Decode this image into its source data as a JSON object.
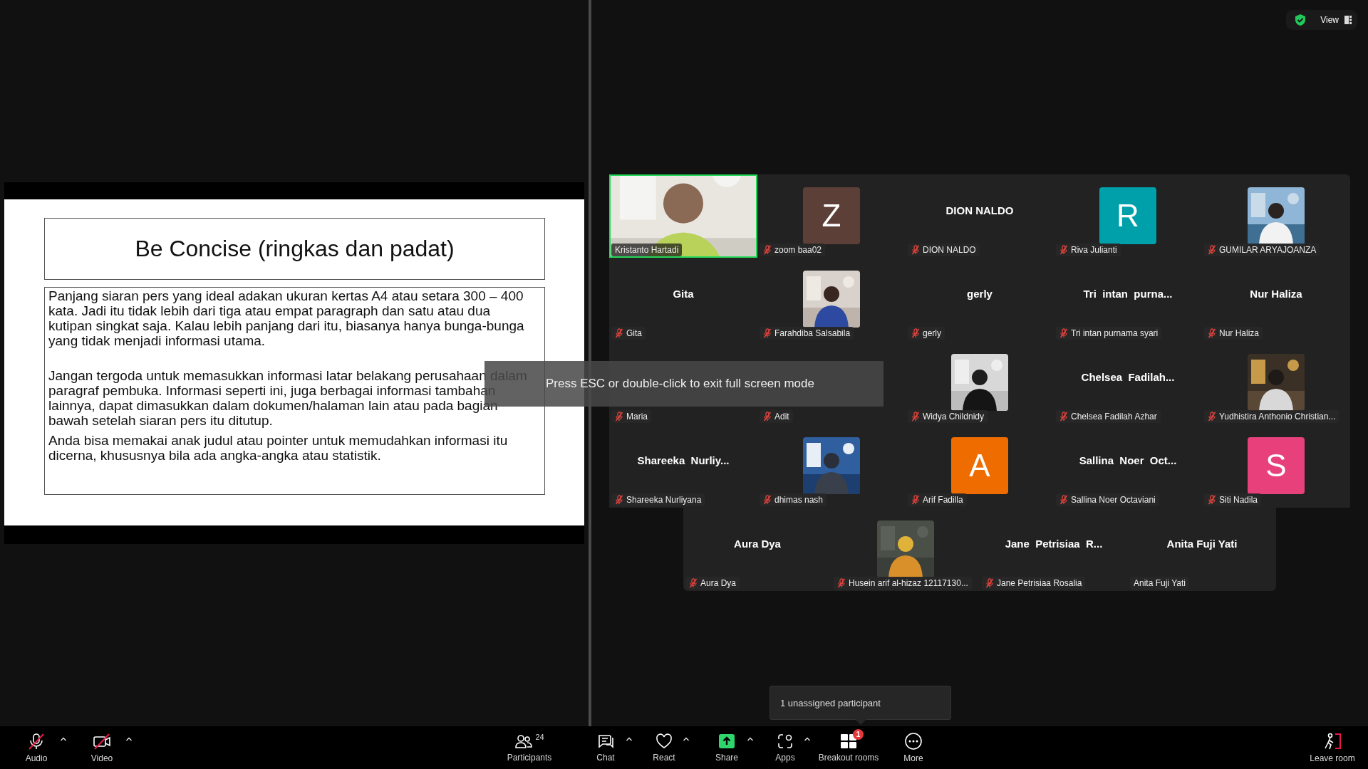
{
  "view_bar": {
    "label": "View"
  },
  "slide": {
    "title": "Be Concise (ringkas dan padat)",
    "paragraphs": [
      "Panjang siaran pers yang ideal adakan ukuran kertas A4 atau setara 300 – 400 kata. Jadi itu tidak lebih dari tiga atau empat paragraph dan satu atau dua kutipan singkat saja. Kalau lebih panjang dari itu, biasanya hanya bunga-bunga yang tidak menjadi informasi utama.",
      "Jangan tergoda untuk memasukkan informasi latar belakang perusahaan dalam paragraf pembuka. Informasi seperti ini, juga berbagai informasi tambahan lainnya, dapat dimasukkan dalam dokumen/halaman lain atau pada bagian bawah setelah siaran pers itu ditutup.",
      "Anda bisa memakai anak judul atau pointer untuk memudahkan informasi itu dicerna, khususnya bila ada angka-angka atau statistik."
    ]
  },
  "fullscreen_notice": "Press ESC or double-click to exit full screen mode",
  "gallery": {
    "rows": [
      {
        "tiles": [
          {
            "kind": "video",
            "name": "Kristanto Hartadi",
            "muted": false,
            "speaking": true
          },
          {
            "kind": "letter",
            "letter": "Z",
            "color": "#5c4038",
            "name": "zoom baa02",
            "muted": true,
            "speaking": false
          },
          {
            "kind": "name",
            "display": "DION NALDO",
            "name": "DION NALDO",
            "muted": true,
            "speaking": false
          },
          {
            "kind": "letter",
            "letter": "R",
            "color": "#00a0ab",
            "name": "Riva Julianti",
            "muted": true,
            "speaking": false
          },
          {
            "name": "GUMILAR ARYAJOANZA",
            "muted": true,
            "speaking": false
          }
        ]
      },
      {
        "tiles": [
          {
            "kind": "name",
            "display": "Gita",
            "name": "Gita",
            "muted": true,
            "speaking": false
          },
          {
            "name": "Farahdiba Salsabila",
            "muted": true,
            "speaking": false
          },
          {
            "kind": "name",
            "display": "gerly",
            "name": "gerly",
            "muted": true,
            "speaking": false
          },
          {
            "kind": "name",
            "display": "Tri  intan  purna...",
            "name": "Tri intan purnama syari",
            "muted": true,
            "speaking": false
          },
          {
            "kind": "name",
            "display": "Nur Haliza",
            "name": "Nur Haliza",
            "muted": true,
            "speaking": false
          }
        ]
      },
      {
        "tiles": [
          {
            "kind": "name",
            "name": "Maria",
            "muted": true,
            "speaking": false
          },
          {
            "kind": "name",
            "name": "Adit",
            "muted": true,
            "speaking": false
          },
          {
            "name": "Widya Childnidy",
            "muted": true,
            "speaking": false
          },
          {
            "kind": "name",
            "display": "Chelsea  Fadilah...",
            "name": "Chelsea Fadilah Azhar",
            "muted": true,
            "speaking": false
          },
          {
            "name": "Yudhistira Anthonio Christian...",
            "muted": true,
            "speaking": false
          }
        ]
      },
      {
        "tiles": [
          {
            "kind": "name",
            "display": "Shareeka  Nurliy...",
            "name": "Shareeka Nurliyana",
            "muted": true,
            "speaking": false
          },
          {
            "name": "dhimas nash",
            "muted": true,
            "speaking": false
          },
          {
            "kind": "letter",
            "letter": "A",
            "color": "#ef6c00",
            "name": "Arif Fadilla",
            "muted": true,
            "speaking": false
          },
          {
            "kind": "name",
            "display": "Sallina  Noer  Oct...",
            "name": "Sallina Noer Octaviani",
            "muted": true,
            "speaking": false
          },
          {
            "kind": "letter",
            "letter": "S",
            "color": "#e8407a",
            "name": "Siti Nadila",
            "muted": true,
            "speaking": false
          }
        ]
      },
      {
        "tiles": [
          {
            "kind": "name",
            "display": "Aura Dya",
            "name": "Aura Dya",
            "muted": true,
            "speaking": false
          },
          {
            "name": "Husein arif al-hizaz 12117130...",
            "muted": true,
            "speaking": false
          },
          {
            "kind": "name",
            "display": "Jane  Petrisiaa  R...",
            "name": "Jane Petrisiaa Rosalia",
            "muted": true,
            "speaking": false
          },
          {
            "kind": "name",
            "display": "Anita Fuji Yati",
            "name": "Anita Fuji Yati",
            "muted": false,
            "speaking": false
          }
        ]
      }
    ]
  },
  "breakout_tooltip": "1 unassigned participant",
  "toolbar": [
    {
      "kind": "audio",
      "label": "Audio",
      "off": true,
      "menu": true
    },
    {
      "kind": "video",
      "label": "Video",
      "off": true,
      "menu": true
    },
    {
      "kind": "participants",
      "label": "Participants",
      "count": "24",
      "menu": false
    },
    {
      "kind": "chat",
      "label": "Chat",
      "menu": true
    },
    {
      "kind": "react",
      "label": "React",
      "menu": true
    },
    {
      "kind": "share",
      "label": "Share",
      "menu": true
    },
    {
      "kind": "apps",
      "label": "Apps",
      "menu": true
    },
    {
      "kind": "breakout",
      "label": "Breakout rooms",
      "badge": "1",
      "menu": false
    },
    {
      "kind": "more",
      "label": "More",
      "menu": false
    },
    {
      "kind": "leave",
      "label": "Leave room",
      "menu": false
    }
  ]
}
